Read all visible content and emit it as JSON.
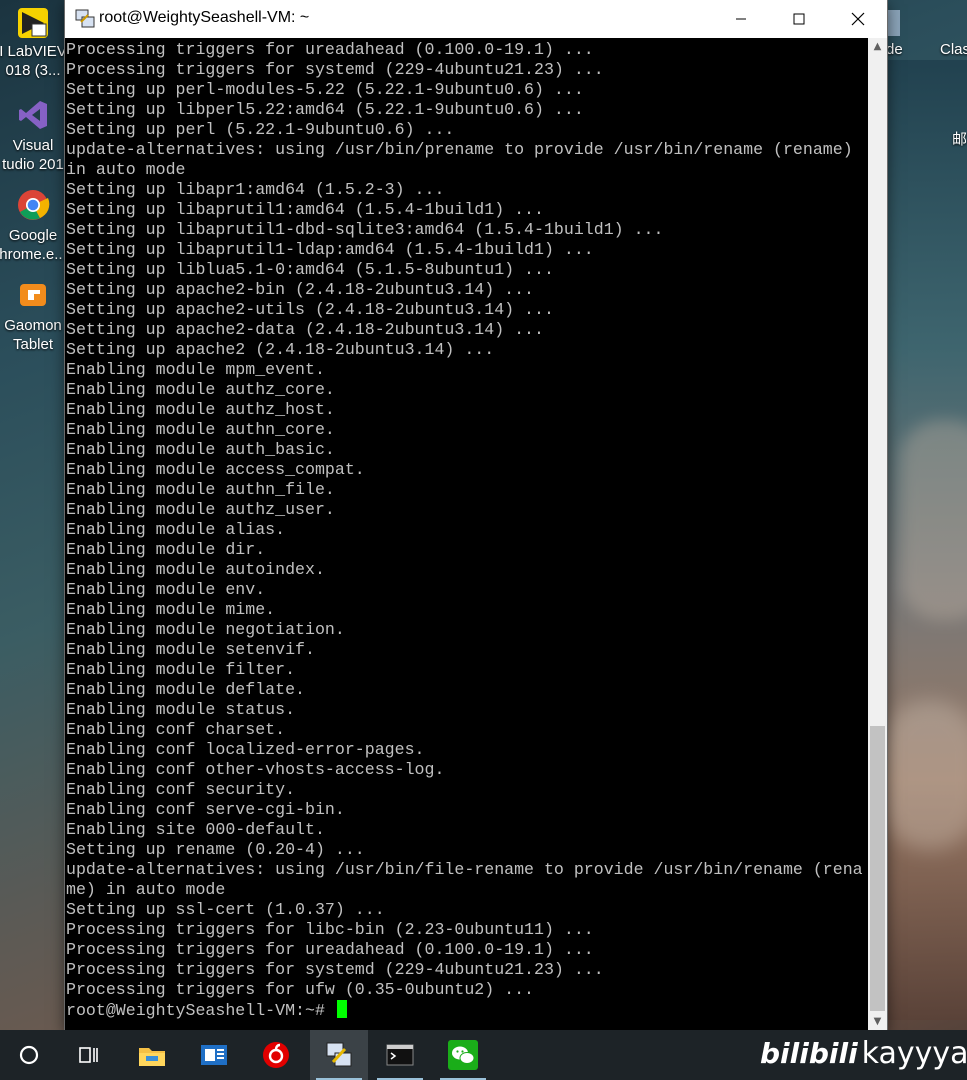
{
  "desktop": {
    "icons_left": [
      {
        "name": "labview",
        "line1": "I LabVIEV",
        "line2": "018 (3..."
      },
      {
        "name": "visual-studio",
        "line1": "Visual",
        "line2": "tudio 201"
      },
      {
        "name": "chrome",
        "line1": "Google",
        "line2": "hrome.e..."
      },
      {
        "name": "gaomon",
        "line1": "Gaomon",
        "line2": "Tablet"
      }
    ],
    "icons_right": [
      {
        "name": "partial-1",
        "label": "de"
      },
      {
        "name": "partial-2",
        "label": "Clas"
      },
      {
        "name": "partial-3",
        "label": "邮"
      }
    ]
  },
  "window": {
    "title": "root@WeightySeashell-VM: ~",
    "prompt": "root@WeightySeashell-VM:~# ",
    "lines": [
      "Processing triggers for ureadahead (0.100.0-19.1) ...",
      "Processing triggers for systemd (229-4ubuntu21.23) ...",
      "Setting up perl-modules-5.22 (5.22.1-9ubuntu0.6) ...",
      "Setting up libperl5.22:amd64 (5.22.1-9ubuntu0.6) ...",
      "Setting up perl (5.22.1-9ubuntu0.6) ...",
      "update-alternatives: using /usr/bin/prename to provide /usr/bin/rename (rename)",
      "in auto mode",
      "Setting up libapr1:amd64 (1.5.2-3) ...",
      "Setting up libaprutil1:amd64 (1.5.4-1build1) ...",
      "Setting up libaprutil1-dbd-sqlite3:amd64 (1.5.4-1build1) ...",
      "Setting up libaprutil1-ldap:amd64 (1.5.4-1build1) ...",
      "Setting up liblua5.1-0:amd64 (5.1.5-8ubuntu1) ...",
      "Setting up apache2-bin (2.4.18-2ubuntu3.14) ...",
      "Setting up apache2-utils (2.4.18-2ubuntu3.14) ...",
      "Setting up apache2-data (2.4.18-2ubuntu3.14) ...",
      "Setting up apache2 (2.4.18-2ubuntu3.14) ...",
      "Enabling module mpm_event.",
      "Enabling module authz_core.",
      "Enabling module authz_host.",
      "Enabling module authn_core.",
      "Enabling module auth_basic.",
      "Enabling module access_compat.",
      "Enabling module authn_file.",
      "Enabling module authz_user.",
      "Enabling module alias.",
      "Enabling module dir.",
      "Enabling module autoindex.",
      "Enabling module env.",
      "Enabling module mime.",
      "Enabling module negotiation.",
      "Enabling module setenvif.",
      "Enabling module filter.",
      "Enabling module deflate.",
      "Enabling module status.",
      "Enabling conf charset.",
      "Enabling conf localized-error-pages.",
      "Enabling conf other-vhosts-access-log.",
      "Enabling conf security.",
      "Enabling conf serve-cgi-bin.",
      "Enabling site 000-default.",
      "Setting up rename (0.20-4) ...",
      "update-alternatives: using /usr/bin/file-rename to provide /usr/bin/rename (rena",
      "me) in auto mode",
      "Setting up ssl-cert (1.0.37) ...",
      "Processing triggers for libc-bin (2.23-0ubuntu11) ...",
      "Processing triggers for ureadahead (0.100.0-19.1) ...",
      "Processing triggers for systemd (229-4ubuntu21.23) ...",
      "Processing triggers for ufw (0.35-0ubuntu2) ..."
    ]
  },
  "taskbar": {
    "items": [
      "cortana-circle",
      "task-view",
      "file-explorer",
      "news-app",
      "netease-music",
      "putty",
      "console",
      "wechat"
    ],
    "active": "putty"
  },
  "watermark": {
    "brand": "bilibili",
    "user": "kayyyak"
  },
  "colors": {
    "terminal_bg": "#000000",
    "terminal_fg": "#c0c0c0",
    "cursor": "#00ff00",
    "taskbar": "#1d2327"
  }
}
